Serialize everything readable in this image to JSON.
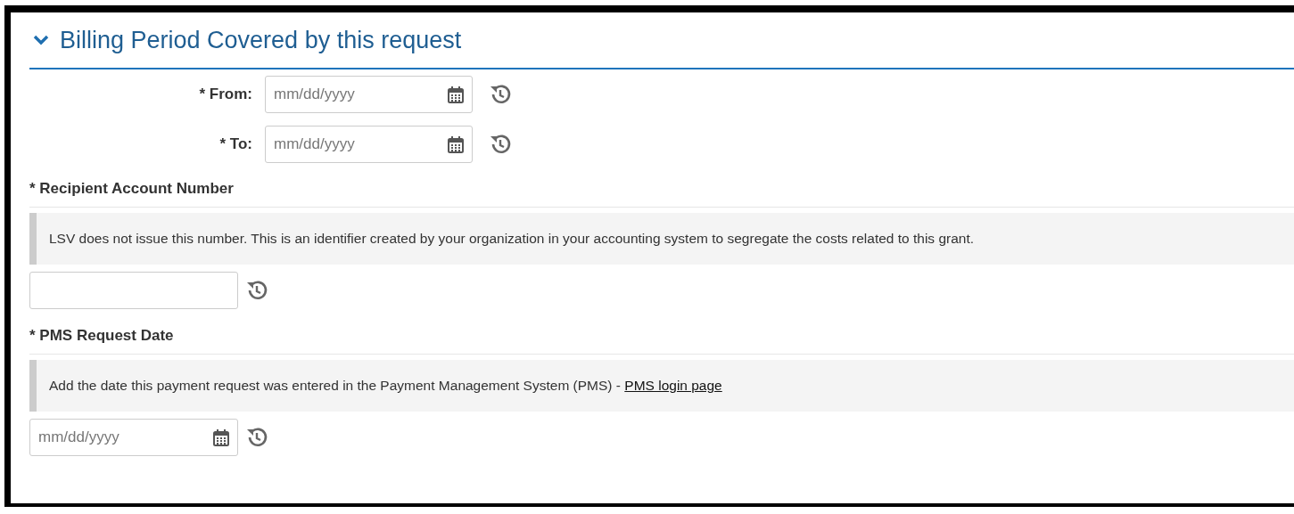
{
  "section": {
    "title": "Billing Period Covered by this request",
    "expanded": true
  },
  "date_range": [
    {
      "label": "* From:",
      "placeholder": "mm/dd/yyyy"
    },
    {
      "label": "* To:",
      "placeholder": "mm/dd/yyyy"
    }
  ],
  "fields": [
    {
      "kind": "text",
      "label": "* Recipient Account Number",
      "help": "LSV does not issue this number. This is an identifier created by your organization in your accounting system to segregate the costs related to this grant."
    },
    {
      "kind": "date",
      "label": "* PMS Request Date",
      "help": "Add the date this payment request was entered in the Payment Management System (PMS) - ",
      "link": "PMS login page",
      "placeholder": "mm/dd/yyyy"
    }
  ]
}
